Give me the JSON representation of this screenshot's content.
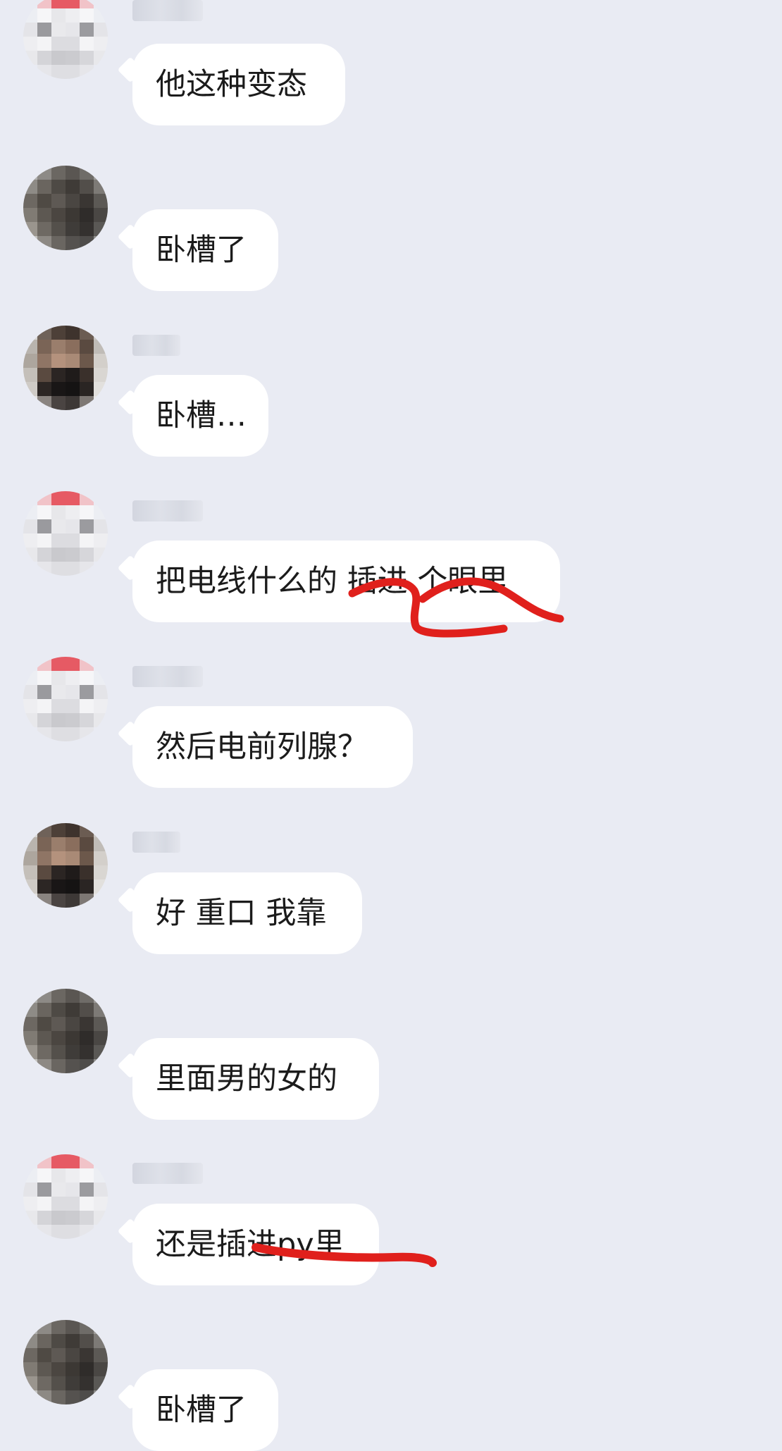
{
  "chat": {
    "messages": [
      {
        "text": "他这种变态",
        "avatar": "santa-hat-avatar"
      },
      {
        "text": "卧槽了",
        "avatar": "dark-avatar"
      },
      {
        "text": "卧槽…",
        "avatar": "face-avatar"
      },
      {
        "text": "把电线什么的 插进 个眼里",
        "avatar": "santa-hat-avatar"
      },
      {
        "text": "然后电前列腺？",
        "avatar": "santa-hat-avatar"
      },
      {
        "text": "好 重口 我靠",
        "avatar": "face-avatar"
      },
      {
        "text": "里面男的女的",
        "avatar": "dark-avatar"
      },
      {
        "text": "还是插进py里",
        "avatar": "santa-hat-avatar"
      },
      {
        "text": "卧槽了",
        "avatar": "dark-avatar"
      }
    ]
  },
  "colors": {
    "background": "#e9ebf3",
    "bubble": "#ffffff",
    "text": "#1b1b1b",
    "annotation_red": "#e0201c"
  }
}
